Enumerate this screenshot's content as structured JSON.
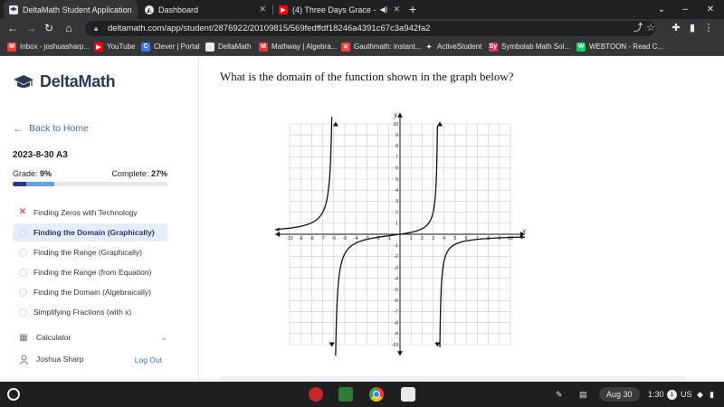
{
  "browser": {
    "tabs": [
      {
        "label": "DeltaMath Student Application",
        "active": true,
        "icon": "deltamath-favicon"
      },
      {
        "label": "Dashboard",
        "active": false,
        "icon": "dashboard-favicon"
      },
      {
        "label": "(4) Three Days Grace - I Hate",
        "active": false,
        "icon": "youtube-favicon"
      }
    ],
    "url": "deltamath.com/app/student/2876922/20109815/569fedffdf18246a4391c67c3a942fa2",
    "bookmarks": [
      {
        "label": "Inbox - joshuasharp...",
        "icon": "gmail-icon",
        "color": "#ea4335",
        "glyph": "M"
      },
      {
        "label": "YouTube",
        "icon": "youtube-icon",
        "color": "#ff0000",
        "glyph": "▶"
      },
      {
        "label": "Clever | Portal",
        "icon": "clever-icon",
        "color": "#4274f6",
        "glyph": "C"
      },
      {
        "label": "DeltaMath",
        "icon": "deltamath-icon",
        "color": "#e8eaed",
        "glyph": ""
      },
      {
        "label": "Mathway | Algebra...",
        "icon": "mathway-icon",
        "color": "#e53935",
        "glyph": "M"
      },
      {
        "label": "Gauthmath: instant...",
        "icon": "gauthmath-icon",
        "color": "#ef4444",
        "glyph": "✕"
      },
      {
        "label": "ActiveStudent",
        "icon": "activestudent-icon",
        "color": "#35363a",
        "glyph": "✦"
      },
      {
        "label": "Symbolab Math Sol...",
        "icon": "symbolab-icon",
        "color": "#d6336c",
        "glyph": "Sy"
      },
      {
        "label": "WEBTOON - Read C...",
        "icon": "webtoon-icon",
        "color": "#00d564",
        "glyph": "W"
      }
    ]
  },
  "app": {
    "brand": "DeltaMath",
    "back_label": "Back to Home",
    "assignment_title": "2023-8-30 A3",
    "grade_label": "Grade:",
    "grade_value": "9%",
    "grade_fraction": 0.09,
    "complete_label": "Complete:",
    "complete_value": "27%",
    "complete_fraction": 0.27,
    "skills": [
      {
        "label": "Finding Zeros with Technology",
        "status": "incorrect"
      },
      {
        "label": "Finding the Domain (Graphically)",
        "status": "current"
      },
      {
        "label": "Finding the Range (Graphically)",
        "status": "todo"
      },
      {
        "label": "Finding the Range (from Equation)",
        "status": "todo"
      },
      {
        "label": "Finding the Domain (Algebraically)",
        "status": "todo"
      },
      {
        "label": "Simplifying Fractions (with x)",
        "status": "todo"
      }
    ],
    "calculator_label": "Calculator",
    "user_name": "Joshua Sharp",
    "logout_label": "Log Out"
  },
  "question": {
    "text": "What is the domain of the function shown in the graph below?"
  },
  "graph": {
    "x_axis_label": "x",
    "y_axis_label": "y",
    "xlim": [
      -10,
      10
    ],
    "ylim": [
      -10,
      10
    ],
    "vertical_asymptotes": [
      -6,
      3.5
    ],
    "x_ticks": [
      "-10",
      "-9",
      "-8",
      "-7",
      "-6",
      "-5",
      "-4",
      "-3",
      "-2",
      "-1",
      "1",
      "2",
      "3",
      "4",
      "5",
      "6",
      "7",
      "8",
      "9",
      "10"
    ],
    "y_ticks": [
      "10",
      "9",
      "8",
      "7",
      "6",
      "5",
      "4",
      "3",
      "2",
      "1",
      "-1",
      "-2",
      "-3",
      "-4",
      "-5",
      "-6",
      "-7",
      "-8",
      "-9",
      "-10"
    ]
  },
  "taskbar": {
    "date": "Aug 30",
    "time": "1:30",
    "notification_count": "1",
    "locale": "US"
  }
}
